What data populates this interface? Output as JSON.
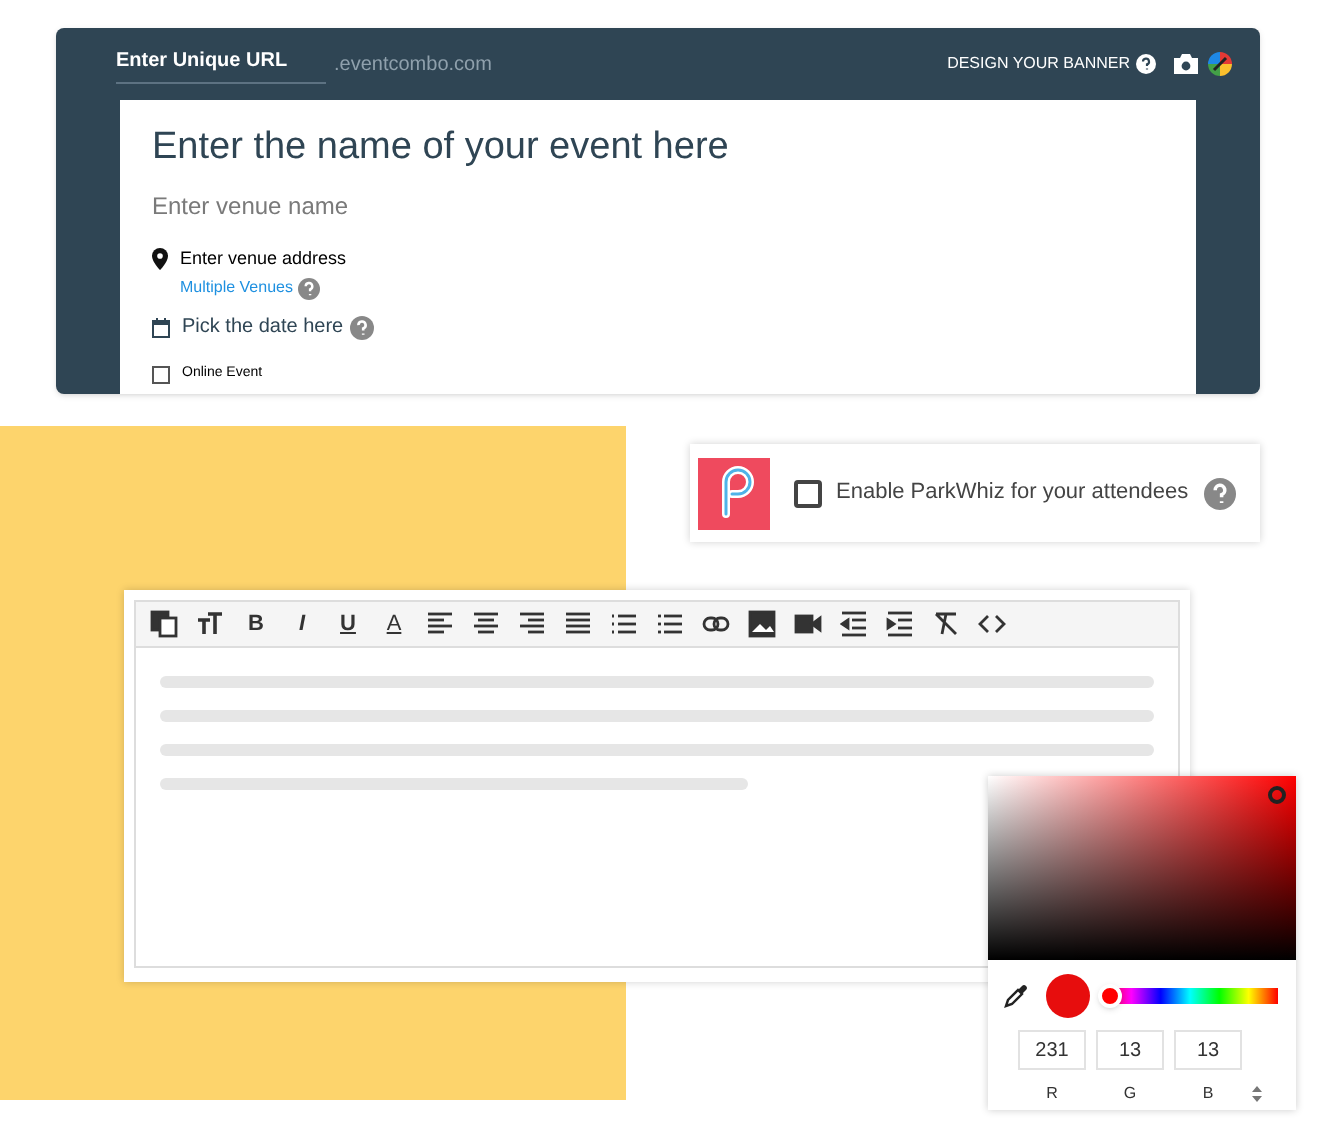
{
  "event_header": {
    "url_field": {
      "placeholder": "Enter Unique URL"
    },
    "domain": ".eventcombo.com",
    "design_banner": "DESIGN YOUR BANNER"
  },
  "event_form": {
    "title": "Enter the name of your event here",
    "venue": "Enter venue name",
    "address": "Enter venue address",
    "multiple_venues": "Multiple Venues",
    "date": "Pick the date here",
    "online_event": {
      "label": "Online Event",
      "checked": false
    }
  },
  "parkwhiz": {
    "label": "Enable ParkWhiz for your attendees",
    "checked": false
  },
  "editor": {
    "toolbar": [
      {
        "kind": "translate"
      },
      {
        "kind": "font-size"
      },
      {
        "kind": "bold",
        "label": "B"
      },
      {
        "kind": "italic",
        "label": "I"
      },
      {
        "kind": "underline",
        "label": "U"
      },
      {
        "kind": "text-color",
        "label": "A"
      },
      {
        "kind": "align-left"
      },
      {
        "kind": "align-center"
      },
      {
        "kind": "align-right"
      },
      {
        "kind": "justify"
      },
      {
        "kind": "bullets"
      },
      {
        "kind": "numbers"
      },
      {
        "kind": "link"
      },
      {
        "kind": "image"
      },
      {
        "kind": "video"
      },
      {
        "kind": "outdent"
      },
      {
        "kind": "indent"
      },
      {
        "kind": "clear-format"
      },
      {
        "kind": "code"
      }
    ]
  },
  "color_picker": {
    "color": "#e70d0d",
    "hue": {
      "level": 0
    },
    "channels": [
      {
        "value": "231",
        "label": "R"
      },
      {
        "value": "13",
        "label": "G"
      },
      {
        "value": "13",
        "label": "B"
      }
    ]
  }
}
